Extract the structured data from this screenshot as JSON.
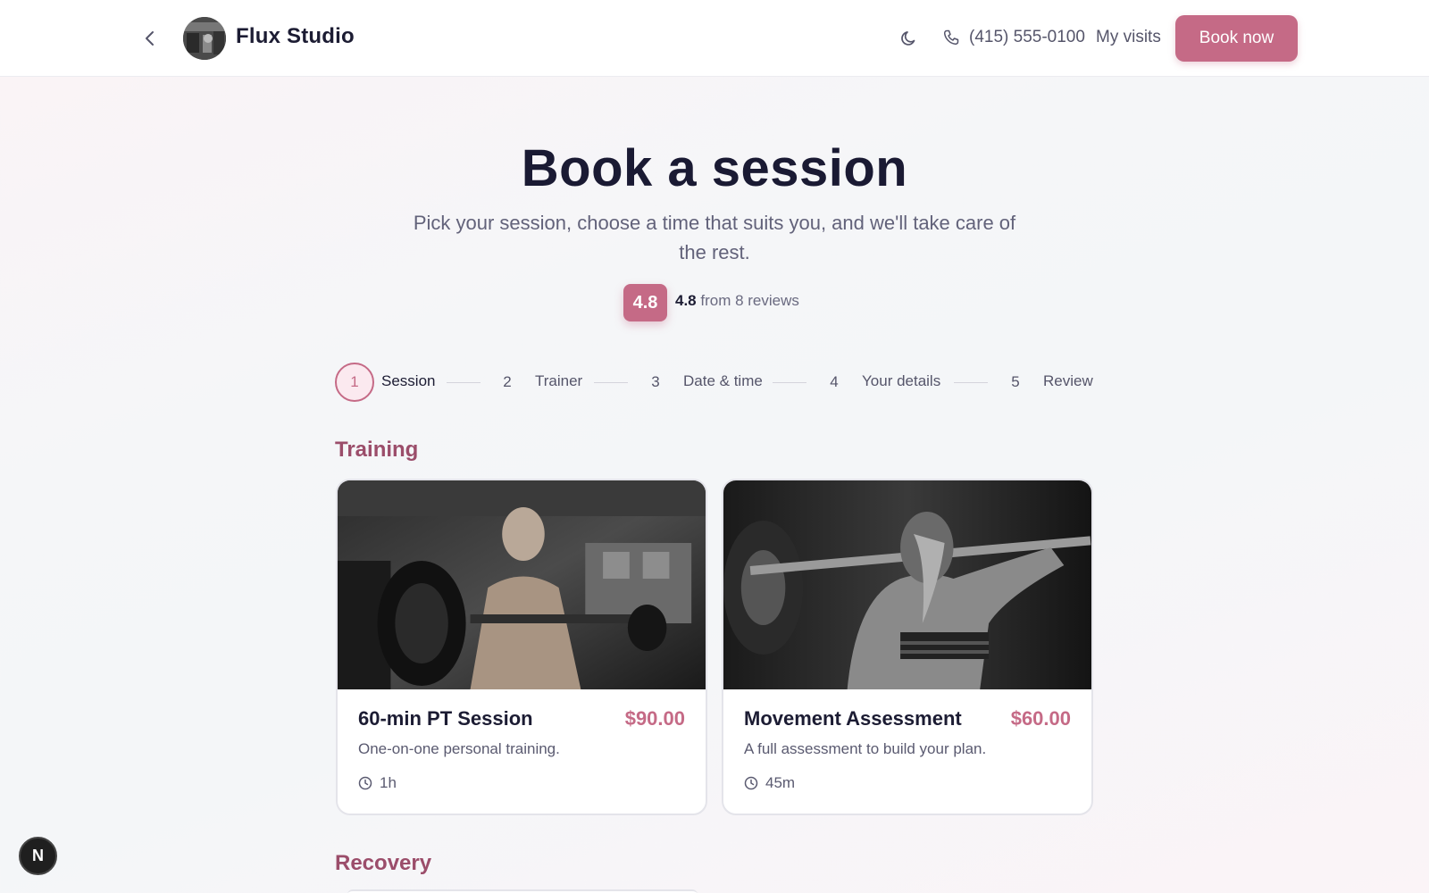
{
  "header": {
    "brand": "Flux Studio",
    "phone": "(415) 555-0100",
    "my_visits": "My visits",
    "book_now": "Book now"
  },
  "hero": {
    "title": "Book a session",
    "subtitle": "Pick your session, choose a time that suits you, and we'll take care of the rest.",
    "rating_badge": "4.8",
    "rating_value": "4.8",
    "rating_suffix": "from 8 reviews"
  },
  "stepper": [
    {
      "num": "1",
      "label": "Session",
      "active": true
    },
    {
      "num": "2",
      "label": "Trainer",
      "active": false
    },
    {
      "num": "3",
      "label": "Date & time",
      "active": false
    },
    {
      "num": "4",
      "label": "Your details",
      "active": false
    },
    {
      "num": "5",
      "label": "Review",
      "active": false
    }
  ],
  "sections": {
    "training": {
      "title": "Training",
      "cards": [
        {
          "name": "60-min PT Session",
          "price": "$90.00",
          "description": "One-on-one personal training.",
          "duration": "1h"
        },
        {
          "name": "Movement Assessment",
          "price": "$60.00",
          "description": "A full assessment to build your plan.",
          "duration": "45m"
        }
      ]
    },
    "recovery": {
      "title": "Recovery"
    }
  },
  "badge": {
    "letter": "N"
  },
  "colors": {
    "accent": "#c56a86",
    "section_title": "#9b4d6a",
    "heading": "#1a1a33"
  },
  "icons": [
    "chevron-left-icon",
    "moon-icon",
    "phone-icon",
    "clock-icon"
  ]
}
